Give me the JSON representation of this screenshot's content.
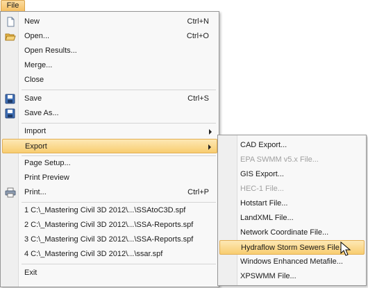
{
  "menubar": {
    "file_label": "File"
  },
  "main_menu": {
    "new": {
      "label": "New",
      "shortcut": "Ctrl+N"
    },
    "open": {
      "label": "Open...",
      "shortcut": "Ctrl+O"
    },
    "open_results": {
      "label": "Open Results..."
    },
    "merge": {
      "label": "Merge..."
    },
    "close": {
      "label": "Close"
    },
    "save": {
      "label": "Save",
      "shortcut": "Ctrl+S"
    },
    "save_as": {
      "label": "Save As..."
    },
    "import": {
      "label": "Import"
    },
    "export": {
      "label": "Export"
    },
    "page_setup": {
      "label": "Page Setup..."
    },
    "print_preview": {
      "label": "Print Preview"
    },
    "print": {
      "label": "Print...",
      "shortcut": "Ctrl+P"
    },
    "recent_files": [
      {
        "label": "1 C:\\_Mastering Civil 3D 2012\\...\\SSAtoC3D.spf"
      },
      {
        "label": "2 C:\\_Mastering Civil 3D 2012\\...\\SSA-Reports.spf"
      },
      {
        "label": "3 C:\\_Mastering Civil 3D 2012\\...\\SSA-Reports.spf"
      },
      {
        "label": "4 C:\\_Mastering Civil 3D 2012\\...\\ssar.spf"
      }
    ],
    "exit": {
      "label": "Exit"
    }
  },
  "export_submenu": [
    {
      "label": "CAD Export...",
      "enabled": true
    },
    {
      "label": "EPA SWMM v5.x File...",
      "enabled": false
    },
    {
      "label": "GIS Export...",
      "enabled": true
    },
    {
      "label": "HEC-1 File...",
      "enabled": false
    },
    {
      "label": "Hotstart File...",
      "enabled": true
    },
    {
      "label": "LandXML File...",
      "enabled": true
    },
    {
      "label": "Network Coordinate File...",
      "enabled": true
    },
    {
      "label": "Hydraflow Storm Sewers File...",
      "enabled": true,
      "highlighted": true
    },
    {
      "label": "Windows Enhanced Metafile...",
      "enabled": true
    },
    {
      "label": "XPSWMM File...",
      "enabled": true
    }
  ],
  "colors": {
    "highlight": "#f8cd70",
    "disabled_text": "#a0a0a0",
    "menu_bg": "#f8f8f8"
  },
  "icons": [
    "new-document-icon",
    "open-folder-icon",
    "save-disk-icon",
    "save-as-disk-icon",
    "print-icon",
    "mouse-pointer-icon"
  ]
}
